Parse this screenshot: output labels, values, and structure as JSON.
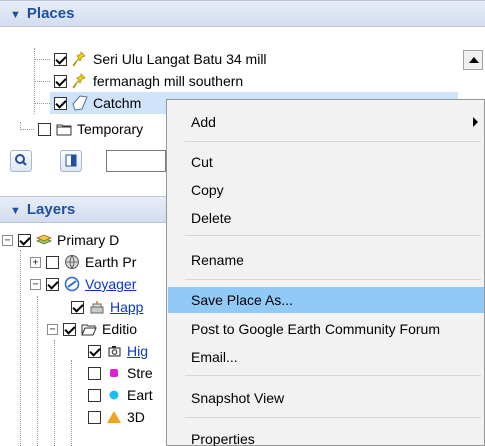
{
  "places_panel": {
    "title": "Places",
    "items": [
      {
        "label": "Seri Ulu Langat Batu 34 mill",
        "checked": true,
        "icon": "yellow-pushpin-icon"
      },
      {
        "label": "fermanagh mill southern",
        "checked": true,
        "icon": "yellow-pushpin-icon"
      },
      {
        "label": "Catchm",
        "checked": true,
        "icon": "polygon-icon"
      },
      {
        "label": "Temporary",
        "checked": false,
        "icon": "folder-icon"
      }
    ]
  },
  "layers_panel": {
    "title": "Layers",
    "items": [
      {
        "label": "Primary D",
        "checked": true,
        "icon": "layers-stack-icon",
        "expander": "−"
      },
      {
        "label": "Earth Pr",
        "checked": false,
        "icon": "globe-icon",
        "expander": "+"
      },
      {
        "label": "Voyager",
        "checked": true,
        "icon": "voyager-icon",
        "expander": "−",
        "link": true
      },
      {
        "label": "Happ",
        "checked": true,
        "icon": "cake-icon",
        "link": true
      },
      {
        "label": "Editio",
        "checked": true,
        "icon": "folder-open-icon",
        "expander": "−"
      },
      {
        "label": "Hig",
        "checked": true,
        "icon": "camera-icon",
        "link": true
      },
      {
        "label": "Stre",
        "checked": false,
        "icon": "magenta-dot-icon"
      },
      {
        "label": "Eart",
        "checked": false,
        "icon": "cyan-dot-icon"
      },
      {
        "label": "3D",
        "checked": false,
        "icon": "orange-triangle-icon"
      }
    ]
  },
  "context_menu": {
    "add": "Add",
    "cut": "Cut",
    "copy": "Copy",
    "delete": "Delete",
    "rename": "Rename",
    "save_place_as": "Save Place As...",
    "post_to_forum": "Post to Google Earth Community Forum",
    "email": "Email...",
    "snapshot_view": "Snapshot View",
    "properties": "Properties"
  },
  "colors": {
    "header_text": "#1f4f9e",
    "menu_highlight": "#91c9f7",
    "selection": "#cfe3fb",
    "link": "#0a36c8"
  }
}
